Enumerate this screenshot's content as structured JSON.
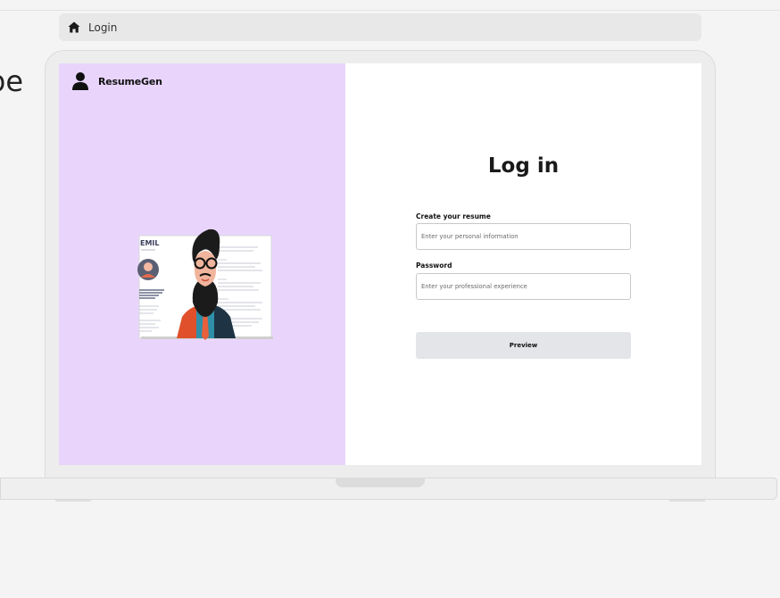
{
  "background_text": "be",
  "tab": {
    "icon": "home-icon",
    "label": "Login"
  },
  "app": {
    "brand_icon": "user-icon",
    "brand_name": "ResumeGen"
  },
  "illustration": {
    "name": "resume-illustration",
    "resume_header_text": "EMIL"
  },
  "form": {
    "title": "Log in",
    "field1": {
      "label": "Create your resume",
      "placeholder": "Enter your personal information",
      "value": ""
    },
    "field2": {
      "label": "Password",
      "placeholder": "Enter your professional experience",
      "value": ""
    },
    "button_label": "Preview"
  },
  "colors": {
    "left_panel": "#e9d5fc",
    "button": "#e4e5e8",
    "accent_jacket": "#e0502b"
  }
}
